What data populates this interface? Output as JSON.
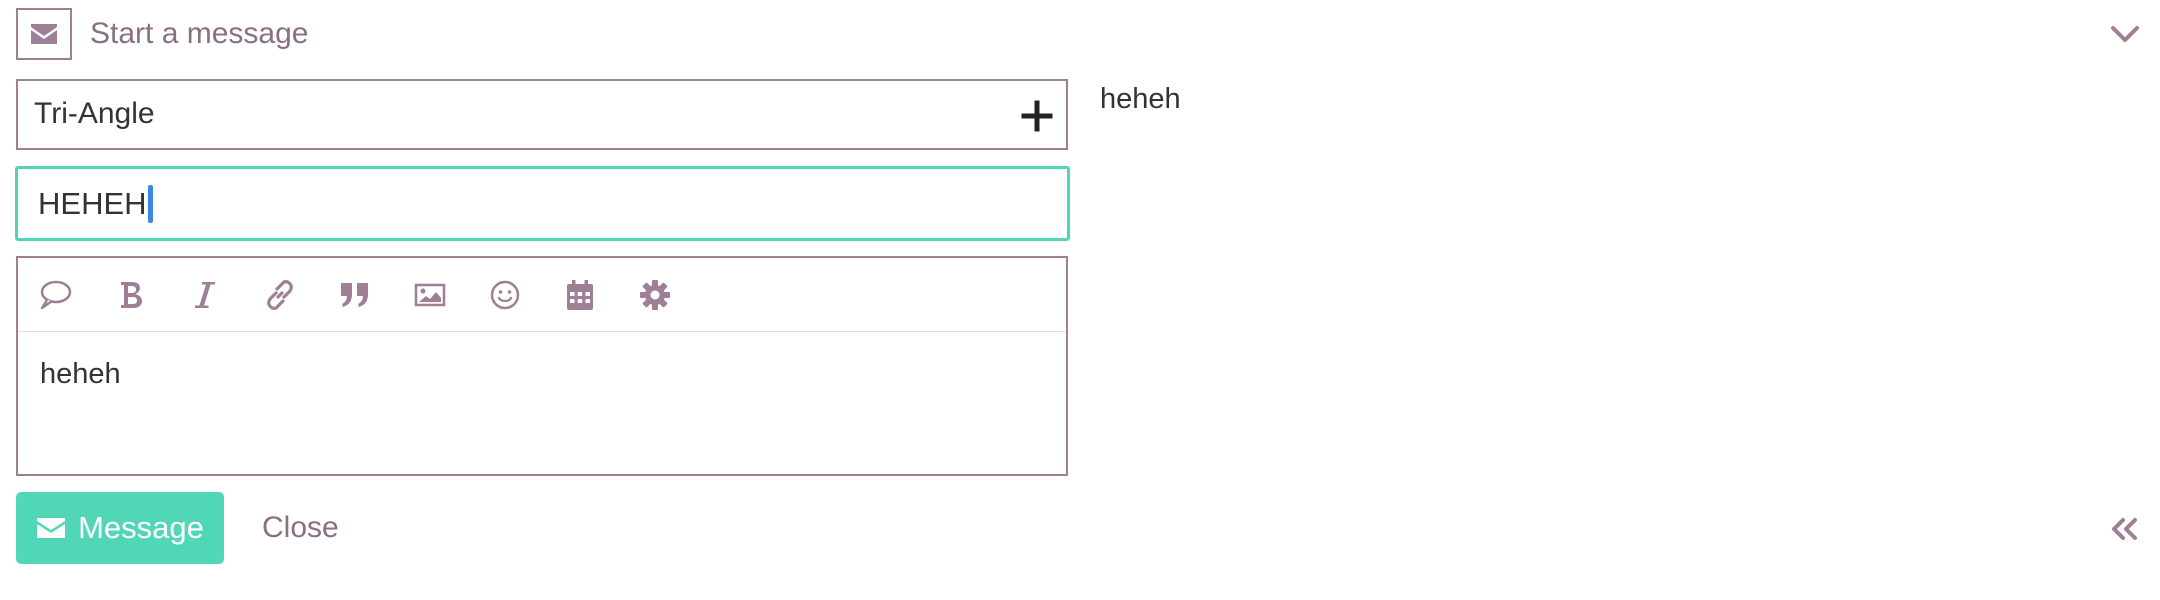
{
  "header": {
    "title": "Start a message",
    "icon": "envelope-icon",
    "toggle_icon": "chevron-down-icon"
  },
  "recipient": {
    "value": "Tri-Angle",
    "add_icon": "plus-icon"
  },
  "subject": {
    "value": "HEHEH"
  },
  "toolbar": {
    "items": [
      "speech-bubble-icon",
      "bold-icon",
      "italic-icon",
      "link-icon",
      "quote-icon",
      "image-icon",
      "emoji-icon",
      "calendar-icon",
      "gear-icon"
    ]
  },
  "editor": {
    "body": "heheh"
  },
  "preview": {
    "text": "heheh"
  },
  "footer": {
    "send_label": "Message",
    "close_label": "Close",
    "collapse_icon": "double-chevron-left-icon"
  },
  "colors": {
    "accent": "#52d6b8",
    "focus_border": "#4fd5b7",
    "muted_purple": "#9e7f95",
    "text": "#333333"
  }
}
